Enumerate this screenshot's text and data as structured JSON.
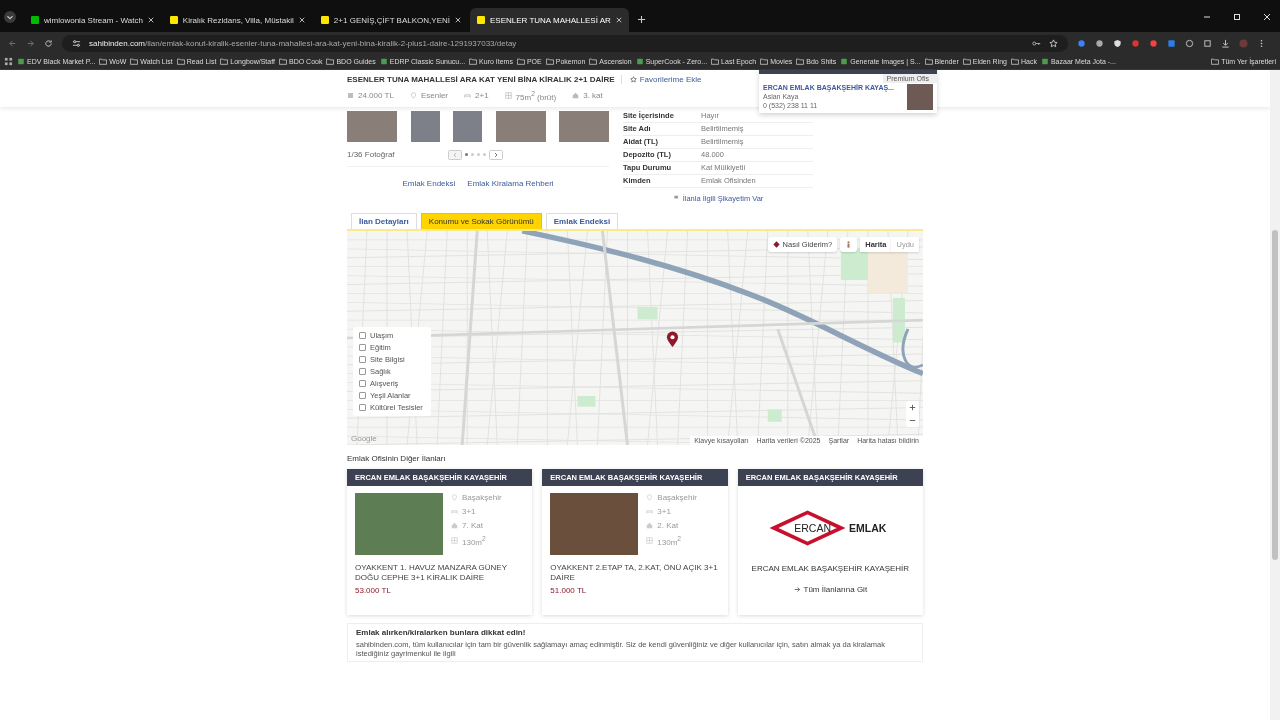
{
  "browser": {
    "tabs": [
      {
        "title": "wimlowonia Stream - Watch",
        "selected": false,
        "kind": "k"
      },
      {
        "title": "Kiralık Rezidans, Villa, Müstakil",
        "selected": false,
        "kind": "s"
      },
      {
        "title": "2+1 GENİŞ,ÇİFT BALKON,YENİ",
        "selected": false,
        "kind": "s"
      },
      {
        "title": "ESENLER TUNA MAHALLESİ AR",
        "selected": true,
        "kind": "s"
      }
    ],
    "address_host": "sahibinden.com",
    "address_path": "/ilan/emlak-konut-kiralik-esenler-tuna-mahallesi-ara-kat-yeni-bina-kiralik-2-plus1-daire-1291937033/detay",
    "bookmarks": [
      {
        "label": "EDV Black Market P...",
        "kind": "site"
      },
      {
        "label": "WoW",
        "kind": "folder"
      },
      {
        "label": "Watch List",
        "kind": "folder"
      },
      {
        "label": "Read List",
        "kind": "folder"
      },
      {
        "label": "Longbow/Staff",
        "kind": "folder"
      },
      {
        "label": "BDO Cook",
        "kind": "folder"
      },
      {
        "label": "BDO Guides",
        "kind": "folder"
      },
      {
        "label": "EDRP Classic Sunucu...",
        "kind": "site"
      },
      {
        "label": "Kuro Items",
        "kind": "folder"
      },
      {
        "label": "POE",
        "kind": "folder"
      },
      {
        "label": "Pokemon",
        "kind": "folder"
      },
      {
        "label": "Ascension",
        "kind": "folder"
      },
      {
        "label": "SuperCook - Zero...",
        "kind": "site"
      },
      {
        "label": "Last Epoch",
        "kind": "folder"
      },
      {
        "label": "Movies",
        "kind": "folder"
      },
      {
        "label": "Bdo Shits",
        "kind": "folder"
      },
      {
        "label": "Generate Images | S...",
        "kind": "site"
      },
      {
        "label": "Blender",
        "kind": "folder"
      },
      {
        "label": "Elden Ring",
        "kind": "folder"
      },
      {
        "label": "Hack",
        "kind": "folder"
      },
      {
        "label": "Bazaar Meta Jota -...",
        "kind": "site"
      }
    ],
    "all_bookmarks": "Tüm Yer İşaretleri"
  },
  "listing": {
    "title": "ESENLER TUNA MAHALLESİ ARA KAT YENİ BİNA KİRALIK 2+1 DAİRE",
    "favorite": "Favorilerime Ekle",
    "meta": [
      {
        "kind": "price",
        "text": "24.000 TL"
      },
      {
        "kind": "location",
        "text": "Esenler"
      },
      {
        "kind": "rooms",
        "text": "2+1"
      },
      {
        "kind": "area",
        "text": "75m$^{2}$ (brüt)"
      },
      {
        "kind": "floor",
        "text": "3. kat"
      }
    ],
    "agent": {
      "badge": "Premium Ofis",
      "office": "ERCAN EMLAK BAŞAKŞEHİR KAYAŞ...",
      "name": "Aslan Kaya",
      "phone": "0 (532) 238 11 11"
    },
    "photo_count": "1/36 Fotoğraf",
    "pager_dots": [
      {
        "selected": true
      },
      {
        "selected": false
      },
      {
        "selected": false
      },
      {
        "selected": false
      }
    ],
    "links": [
      "Emlak Endeksi",
      "Emlak Kiralama Rehberi"
    ],
    "details": [
      {
        "label": "Site İçerisinde",
        "value": "Hayır"
      },
      {
        "label": "Site Adı",
        "value": "Belirtilmemiş"
      },
      {
        "label": "Aidat (TL)",
        "value": "Belirtilmemiş"
      },
      {
        "label": "Depozito (TL)",
        "value": "48.000"
      },
      {
        "label": "Tapu Durumu",
        "value": "Kat Mülkiyetli"
      },
      {
        "label": "Kimden",
        "value": "Emlak Ofisinden"
      }
    ],
    "complaint": "İlanla İlgili Şikayetim Var"
  },
  "tabs": [
    {
      "label": "İlan Detayları",
      "selected": false
    },
    {
      "label": "Konumu ve Sokak Görünümü",
      "selected": true
    },
    {
      "label": "Emlak Endeksi",
      "selected": false
    }
  ],
  "map": {
    "directions": "Nasıl Giderim?",
    "types": [
      {
        "label": "Harita",
        "selected": true
      },
      {
        "label": "Uydu",
        "selected": false
      }
    ],
    "layers": [
      {
        "label": "Ulaşım",
        "checked": false
      },
      {
        "label": "Eğitim",
        "checked": false
      },
      {
        "label": "Site Bilgisi",
        "checked": false
      },
      {
        "label": "Sağlık",
        "checked": false
      },
      {
        "label": "Alışveriş",
        "checked": false
      },
      {
        "label": "Yeşil Alanlar",
        "checked": false
      },
      {
        "label": "Kültürel Tesisler",
        "checked": false
      }
    ],
    "logo": "Google",
    "attribution": [
      "Klavye kısayolları",
      "Harita verileri ©2025",
      "Şartlar",
      "Harita hatası bildirin"
    ]
  },
  "other_listings": {
    "title": "Emlak Ofisinin Diğer İlanları",
    "cards": [
      {
        "kind": "listing",
        "header": "ERCAN EMLAK BAŞAKŞEHİR KAYAŞEHİR",
        "facts": [
          {
            "kind": "location",
            "text": "Başakşehir"
          },
          {
            "kind": "rooms",
            "text": "3+1"
          },
          {
            "kind": "floor",
            "text": "7. Kat"
          },
          {
            "kind": "area",
            "text": "130m$^{2}$"
          }
        ],
        "title": "OYAKKENT 1. HAVUZ MANZARA GÜNEY DOĞU CEPHE 3+1 KİRALIK DAİRE",
        "price": "53.000 TL"
      },
      {
        "kind": "listing",
        "header": "ERCAN EMLAK BAŞAKŞEHİR KAYAŞEHİR",
        "facts": [
          {
            "kind": "location",
            "text": "Başakşehir"
          },
          {
            "kind": "rooms",
            "text": "3+1"
          },
          {
            "kind": "floor",
            "text": "2. Kat"
          },
          {
            "kind": "area",
            "text": "130m$^{2}$"
          }
        ],
        "title": "OYAKKENT 2.ETAP TA, 2.KAT, ÖNÜ AÇIK 3+1 DAİRE",
        "price": "51.000 TL"
      },
      {
        "kind": "office",
        "header": "ERCAN EMLAK BAŞAKŞEHİR KAYAŞEHİR",
        "logo_left": "ERCAN",
        "logo_right": "EMLAK",
        "name": "ERCAN EMLAK BAŞAKŞEHİR KAYAŞEHİR",
        "link": "Tüm İlanlarına Git"
      }
    ]
  },
  "notice": {
    "title": "Emlak alırken/kiralarken bunlara dikkat edin!",
    "text": "sahibinden.com, tüm kullanıcılar için tam bir güvenlik sağlamayı amaç edinmiştir. Siz de kendi güvenliğiniz ve diğer kullanıcılar için, satın almak ya da kiralamak istediğiniz gayrimenkul ile ilgili"
  }
}
